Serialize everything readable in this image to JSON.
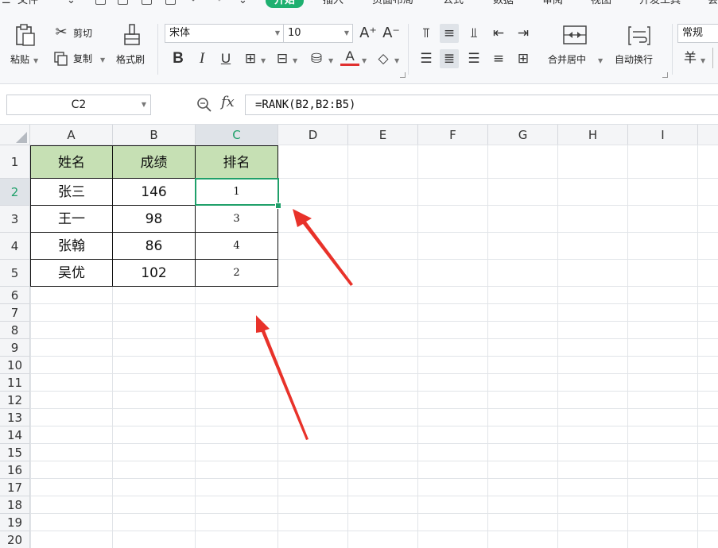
{
  "menu": {
    "file_label": "文件",
    "tabs": [
      {
        "label": "开始"
      },
      {
        "label": "插入"
      },
      {
        "label": "页面布局"
      },
      {
        "label": "公式"
      },
      {
        "label": "数据"
      },
      {
        "label": "审阅"
      },
      {
        "label": "视图"
      },
      {
        "label": "开发工具"
      }
    ]
  },
  "toolbar": {
    "paste_label": "粘贴",
    "cut_label": "剪切",
    "copy_label": "复制",
    "format_painter_label": "格式刷",
    "font_name": "宋体",
    "font_size": "10",
    "merge_center_label": "合并居中",
    "wrap_text_label": "自动换行",
    "number_format": "常规",
    "currency_symbol": "羊"
  },
  "formula_bar": {
    "name_box": "C2",
    "fx_symbol": "fx",
    "formula": "=RANK(B2,B2:B5)"
  },
  "grid": {
    "columns": [
      "A",
      "B",
      "C",
      "D",
      "E",
      "F",
      "G",
      "H",
      "I"
    ],
    "rows": [
      "1",
      "2",
      "3",
      "4",
      "5",
      "6",
      "7",
      "8",
      "9",
      "10",
      "11",
      "12",
      "13",
      "14",
      "15",
      "16",
      "17",
      "18",
      "19",
      "20"
    ],
    "active_cell": "C2",
    "header_fill": "#c6e0b4",
    "selection_color": "#1fa06a"
  },
  "table": {
    "headers": [
      "姓名",
      "成绩",
      "排名"
    ],
    "rows": [
      [
        "张三",
        "146",
        "1"
      ],
      [
        "王一",
        "98",
        "3"
      ],
      [
        "张翰",
        "86",
        "4"
      ],
      [
        "吴优",
        "102",
        "2"
      ]
    ]
  },
  "annotations": {
    "arrow_color": "#e8322a"
  },
  "theme": {
    "accent": "#1fb070"
  }
}
